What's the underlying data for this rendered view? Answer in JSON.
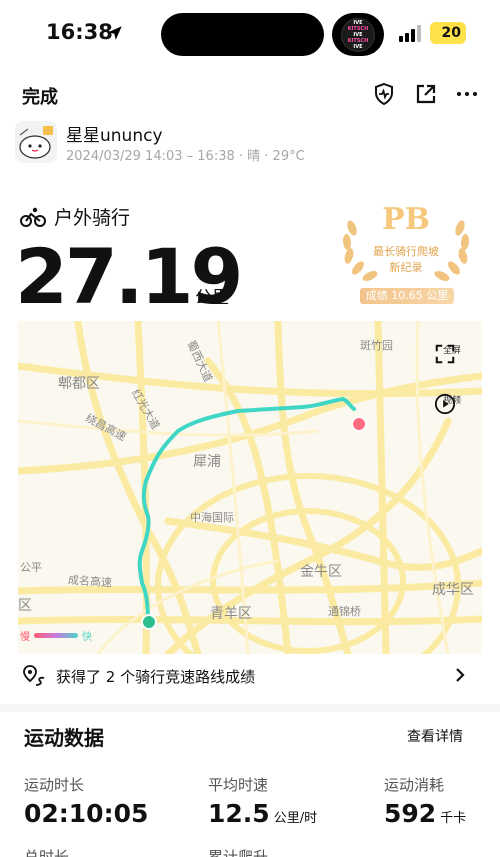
{
  "status_bar": {
    "time": "16:38",
    "battery": "20",
    "island_badge": [
      "IVE",
      "KITSCH",
      "IVE",
      "KITSCH",
      "IVE"
    ]
  },
  "header": {
    "done_label": "完成"
  },
  "user": {
    "name": "星星ununcy",
    "meta": "2024/03/29 14:03 – 16:38 · 晴 · 29°C"
  },
  "activity": {
    "type": "户外骑行",
    "distance": "27.19",
    "distance_unit": "公里"
  },
  "pb_badge": {
    "title": "PB",
    "line1": "最长骑行爬坡",
    "line2": "新纪录",
    "score": "成绩 10.65 公里"
  },
  "map": {
    "labels": [
      "郫都区",
      "犀浦",
      "中海国际",
      "金牛区",
      "青羊区",
      "通锦桥",
      "成华区",
      "斑竹园",
      "公平",
      "区",
      "成名高速",
      "红光大道",
      "蜀西大道",
      "绕昌高速"
    ],
    "fullscreen_label": "全屏",
    "video_label": "视频",
    "legend_slow": "慢",
    "legend_fast": "快",
    "colors": {
      "route": "#3fd6c6",
      "start": "#2dbf8f",
      "end": "#ff6b81",
      "road": "#fbeaa1"
    }
  },
  "segments": {
    "text": "获得了 2 个骑行竞速路线成绩"
  },
  "sport_data": {
    "title": "运动数据",
    "detail_link": "查看详情",
    "stats": [
      {
        "label": "运动时长",
        "value": "02:10:05",
        "unit": ""
      },
      {
        "label": "平均时速",
        "value": "12.5",
        "unit": "公里/时"
      },
      {
        "label": "运动消耗",
        "value": "592",
        "unit": "千卡"
      }
    ],
    "next_labels": [
      "总时长",
      "累计爬升"
    ]
  }
}
